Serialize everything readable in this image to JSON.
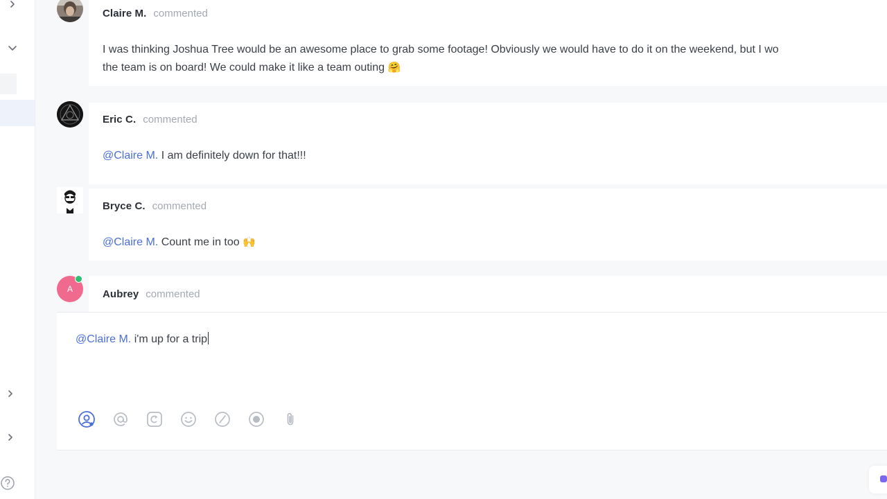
{
  "colors": {
    "mention": "#4a6fd8",
    "online_dot": "#2fbf71",
    "aubrey_avatar": "#f06a8e",
    "accent": "#7b68ee"
  },
  "rail": {
    "icons": [
      "chevron-right-icon",
      "chevron-down-icon",
      "chevron-right-icon",
      "chevron-right-icon",
      "help-icon"
    ]
  },
  "comments": [
    {
      "author": "Claire M.",
      "action": "commented",
      "avatar": "photo-avatar",
      "text": "I was thinking Joshua Tree would be an awesome place to grab some footage! Obviously we would have to do it on the weekend, but I wo",
      "text_line2": "the team is on board! We could make it like a team outing",
      "emoji": "🤗"
    },
    {
      "author": "Eric C.",
      "action": "commented",
      "avatar": "geometric-avatar",
      "mention": "@Claire M.",
      "text": "I am definitely down for that!!!"
    },
    {
      "author": "Bryce C.",
      "action": "commented",
      "avatar": "illustrated-avatar",
      "mention": "@Claire M.",
      "text": "Count me in too",
      "emoji": "🙌"
    },
    {
      "author": "Aubrey",
      "action": "commented",
      "avatar_initial": "A"
    }
  ],
  "composer": {
    "mention": "@Claire M.",
    "value": "i'm up for a trip",
    "tools": [
      "assign-user-icon",
      "mention-icon",
      "task-link-icon",
      "emoji-icon",
      "slash-command-icon",
      "record-icon",
      "attachment-icon"
    ]
  }
}
